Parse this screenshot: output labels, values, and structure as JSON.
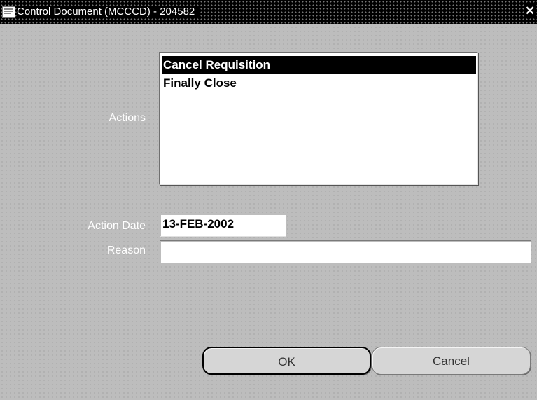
{
  "window": {
    "title": "Control Document (MCCCD) - 204582",
    "app_icon": "oracle-app-icon",
    "close_glyph": "✕"
  },
  "form": {
    "actions_label": "Actions",
    "actions": [
      {
        "label": "Cancel Requisition",
        "selected": true
      },
      {
        "label": "Finally Close",
        "selected": false
      }
    ],
    "action_date_label": "Action Date",
    "action_date_value": "13-FEB-2002",
    "reason_label": "Reason",
    "reason_value": ""
  },
  "buttons": {
    "ok_label": "OK",
    "cancel_label": "Cancel"
  }
}
